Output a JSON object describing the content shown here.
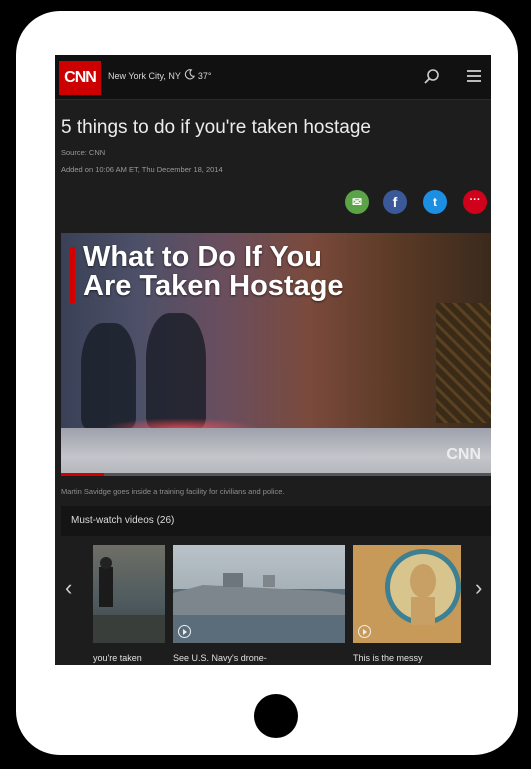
{
  "header": {
    "logo_text": "CNN",
    "location": "New York City, NY",
    "temperature": "37°"
  },
  "article": {
    "headline": "5 things to do if you're taken hostage",
    "source": "Source: CNN",
    "added": "Added on 10:06 AM ET, Thu December 18, 2014"
  },
  "share": {
    "email": "✉",
    "facebook": "f",
    "twitter": "t",
    "more": "···"
  },
  "video": {
    "title_line1": "What to Do If You",
    "title_line2": "Are Taken Hostage",
    "watermark": "CNN",
    "progress_fraction": 0.1,
    "caption": "Martin Savidge goes inside a training facility for civilians and police."
  },
  "must_watch": {
    "label": "Must-watch videos (26)",
    "items": [
      {
        "label": "you're taken"
      },
      {
        "label": "See U.S. Navy's drone-"
      },
      {
        "label": "This is the messy"
      }
    ]
  },
  "colors": {
    "cnn_red": "#cc0000",
    "email": "#5aa447",
    "facebook": "#3b5998",
    "twitter": "#1d8fe2"
  },
  "icons": [
    "search-icon",
    "menu-icon",
    "weather-icon",
    "email-icon",
    "facebook-icon",
    "twitter-icon",
    "more-icon",
    "play-icon",
    "chevron-left-icon",
    "chevron-right-icon"
  ]
}
